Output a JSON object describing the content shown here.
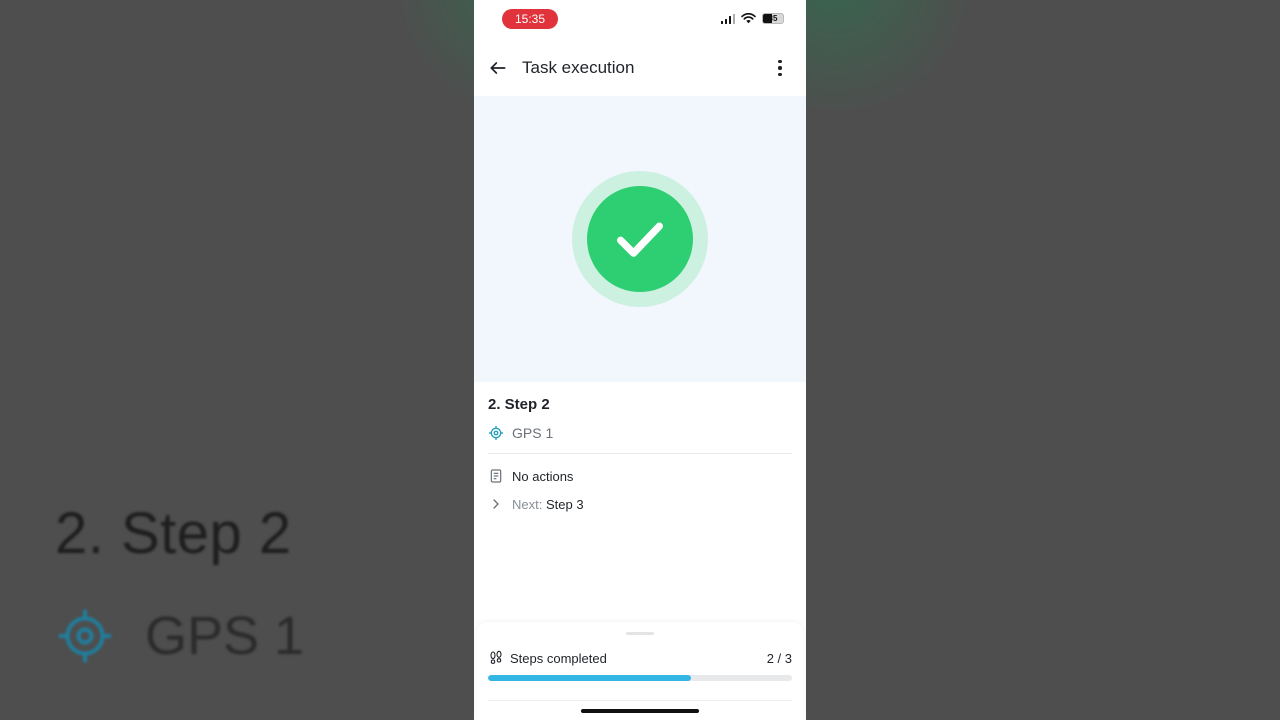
{
  "status_bar": {
    "time": "15:35",
    "battery": "35"
  },
  "appbar": {
    "title": "Task execution"
  },
  "step": {
    "title": "2. Step 2",
    "location": "GPS 1",
    "actions": "No actions",
    "next_prefix": "Next:",
    "next_value": "Step 3"
  },
  "progress": {
    "label": "Steps completed",
    "count": "2 / 3",
    "fraction": 0.667
  },
  "background": {
    "title": "2. Step 2",
    "location": "GPS 1"
  },
  "colors": {
    "success": "#2ecf72",
    "success_halo": "#cdf1e0",
    "progress": "#33b6e4",
    "accent_icon": "#1f7f9e",
    "time_pill": "#e0333b"
  },
  "icons": [
    "back-arrow-icon",
    "more-vertical-icon",
    "check-icon",
    "gps-target-icon",
    "document-icon",
    "chevron-right-icon",
    "footsteps-icon",
    "signal-icon",
    "wifi-icon",
    "battery-icon"
  ]
}
